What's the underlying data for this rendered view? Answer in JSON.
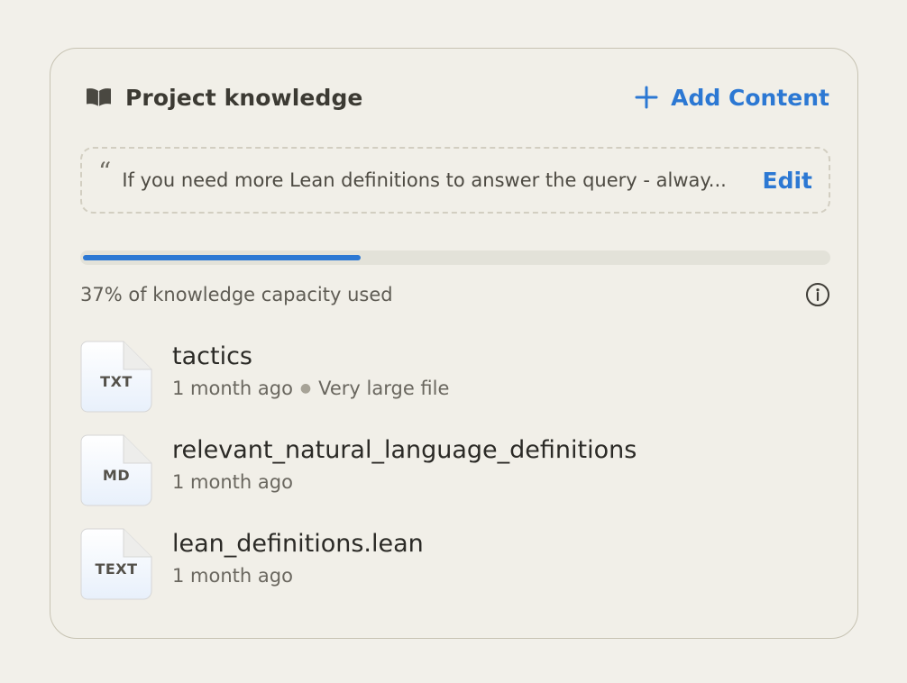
{
  "header": {
    "title": "Project knowledge",
    "add_content_label": "Add Content",
    "book_icon": "book-icon",
    "plus_icon": "plus-icon",
    "accent_color": "#2c78d3"
  },
  "instructions": {
    "quote_mark": "“",
    "text": "If you need more Lean definitions to answer the query - alway...",
    "edit_label": "Edit"
  },
  "capacity": {
    "percent_used": 37,
    "label": "37% of knowledge capacity used",
    "info_icon": "info-icon"
  },
  "files": [
    {
      "type": "TXT",
      "name": "tactics",
      "age": "1 month ago",
      "note": "Very large file"
    },
    {
      "type": "MD",
      "name": "relevant_natural_language_definitions",
      "age": "1 month ago",
      "note": ""
    },
    {
      "type": "TEXT",
      "name": "lean_definitions.lean",
      "age": "1 month ago",
      "note": ""
    }
  ]
}
